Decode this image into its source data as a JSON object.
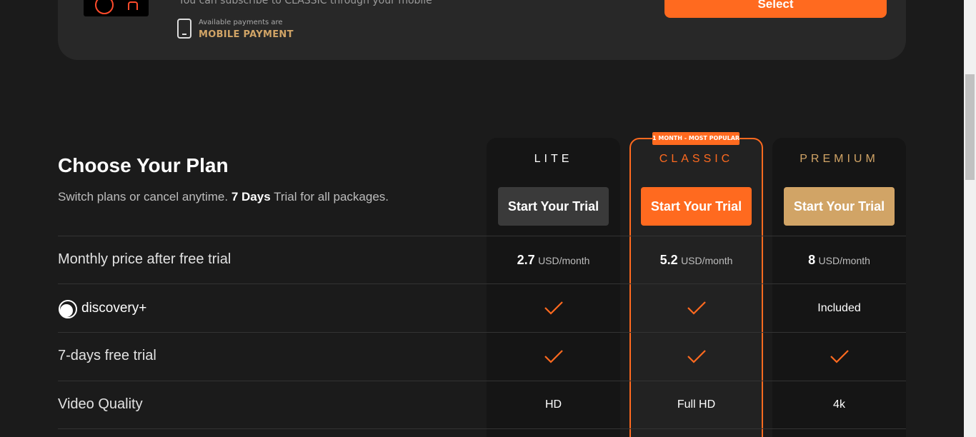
{
  "top_card": {
    "subtitle": "You can subscribe to CLASSIC through your mobile",
    "payments_small": "Available payments are",
    "payments_method": "MOBILE PAYMENT",
    "select_label": "Select"
  },
  "header": {
    "title": "Choose Your Plan",
    "subtitle_pre": "Switch plans or cancel anytime. ",
    "subtitle_bold": "7 Days",
    "subtitle_post": " Trial for all packages."
  },
  "plans": [
    {
      "name": "LITE",
      "button": "Start Your Trial",
      "price": "2.7",
      "unit": "USD/month",
      "discovery": "check",
      "trial": "check",
      "quality": "HD",
      "color": "#ffffff",
      "button_color": "#3a3a3a"
    },
    {
      "name": "CLASSIC",
      "badge": "1 MONTH - MOST POPULAR",
      "button": "Start Your Trial",
      "price": "5.2",
      "unit": "USD/month",
      "discovery": "check",
      "trial": "check",
      "quality": "Full HD",
      "color": "#ff6a1f",
      "button_color": "#ff6a1f"
    },
    {
      "name": "PREMIUM",
      "button": "Start Your Trial",
      "price": "8",
      "unit": "USD/month",
      "discovery": "Included",
      "trial": "check",
      "quality": "4k",
      "color": "#d1a466",
      "button_color": "#d1a466"
    }
  ],
  "rows": {
    "price_label": "Monthly price after free trial",
    "discovery_label": "discovery+",
    "trial_label": "7-days free trial",
    "quality_label": "Video Quality"
  },
  "icons": {
    "check": "check-icon",
    "phone": "phone-icon",
    "discovery": "discovery-logo-icon"
  }
}
